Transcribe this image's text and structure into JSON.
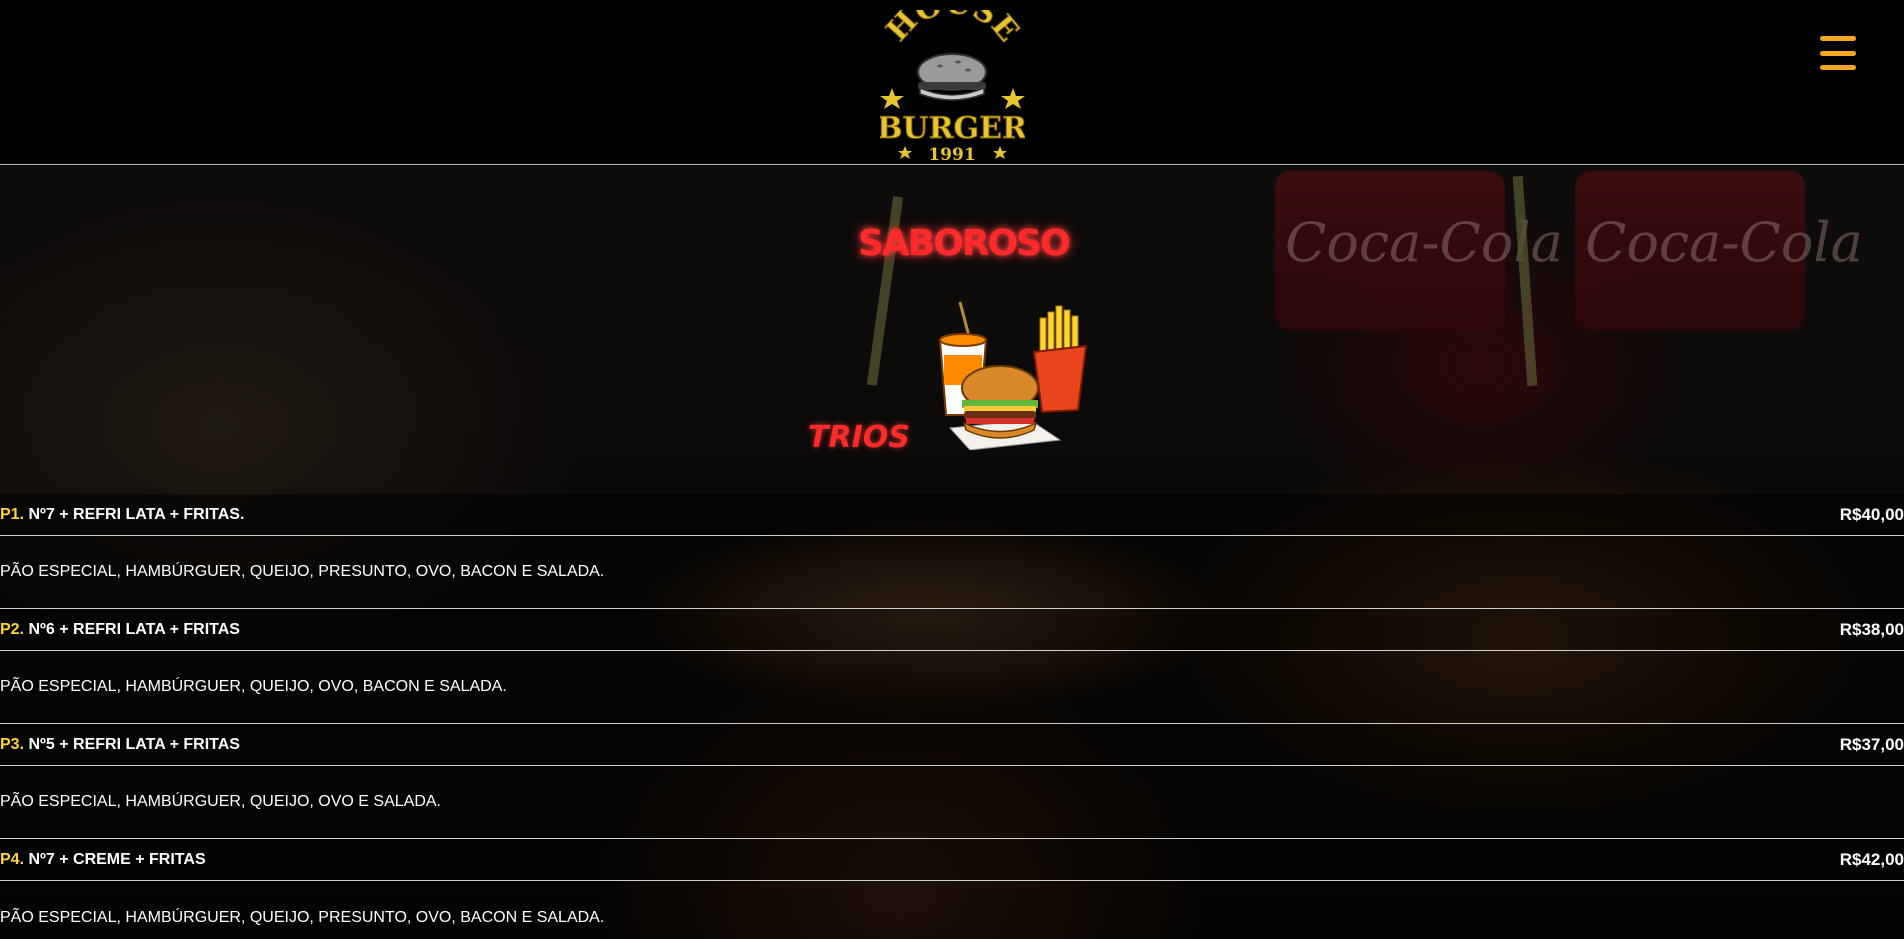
{
  "header": {
    "logo": {
      "line1": "HOUSE",
      "line2": "BURGER",
      "line3": "1991"
    },
    "menu_icon": "hamburger-menu-icon"
  },
  "hero": {
    "headline": "SABOROSO",
    "category": "TRIOS",
    "illustration": "drink-burger-fries-combo"
  },
  "menu": {
    "items": [
      {
        "code": "P1",
        "title": "Nº7 + REFRI LATA + FRITAS.",
        "price": "R$40,00",
        "description": "PÃO ESPECIAL, HAMBÚRGUER, QUEIJO, PRESUNTO, OVO, BACON E SALADA."
      },
      {
        "code": "P2",
        "title": "Nº6 + REFRI LATA + FRITAS",
        "price": "R$38,00",
        "description": "PÃO ESPECIAL, HAMBÚRGUER, QUEIJO, OVO, BACON E SALADA."
      },
      {
        "code": "P3",
        "title": "Nº5 + REFRI LATA + FRITAS",
        "price": "R$37,00",
        "description": "PÃO ESPECIAL, HAMBÚRGUER, QUEIJO, OVO E SALADA."
      },
      {
        "code": "P4",
        "title": "Nº7 + CREME + FRITAS",
        "price": "R$42,00",
        "description": "PÃO ESPECIAL, HAMBÚRGUER, QUEIJO, PRESUNTO, OVO, BACON E SALADA."
      }
    ]
  },
  "colors": {
    "accent_yellow": "#ffd531",
    "menu_icon_orange": "#f5a623",
    "headline_red": "#ff2a2a"
  }
}
